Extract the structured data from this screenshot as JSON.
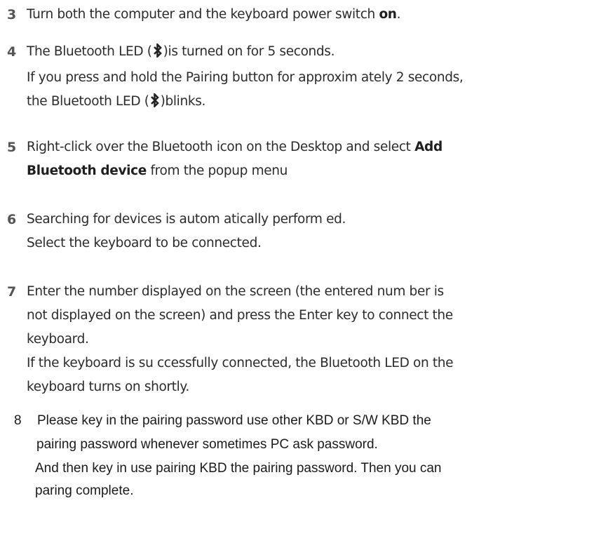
{
  "steps": [
    {
      "number": "3",
      "lines": [
        {
          "pre": "Turn both the computer and the keyboard power switch ",
          "bold": "on",
          "post": "."
        }
      ]
    },
    {
      "number": "4",
      "lines": [
        {
          "pre": "The Bluetooth LED (",
          "icon": "bluetooth-icon",
          "post": ")is turned on for 5 seconds."
        },
        {
          "text": "If you press and hold the Pairing button for approxim ately 2 seconds,"
        },
        {
          "pre": "the Bluetooth LED (",
          "icon": "bluetooth-icon",
          "post": ")blinks."
        }
      ]
    },
    {
      "number": "5",
      "lines": [
        {
          "pre": "Right-click over the Bluetooth icon on the Desktop and select ",
          "bold": "Add"
        },
        {
          "bold": "Bluetooth device",
          "post": " from the popup menu"
        }
      ]
    },
    {
      "number": "6",
      "lines": [
        {
          "text": "Searching for devices is autom atically perform ed."
        },
        {
          "text": "Select the keyboard to be connected."
        }
      ]
    },
    {
      "number": "7",
      "lines": [
        {
          "text": "Enter the number displayed on the screen (the entered num ber is"
        },
        {
          "text": "not displayed on the screen) and press the Enter key to connect the"
        },
        {
          "text": "keyboard."
        },
        {
          "text": "If the keyboard is su ccessfully connected, the Bluetooth LED on the"
        },
        {
          "text": "keyboard turns on shortly."
        }
      ]
    },
    {
      "number": "8",
      "lines": [
        {
          "text": "Please key in the pairing password use other KBD or S/W KBD the"
        },
        {
          "text": "pairing password whenever sometimes PC ask password."
        },
        {
          "text": "And then key in use pairing KBD the pairing password.  Then you can"
        },
        {
          "text": "paring complete."
        }
      ]
    }
  ],
  "colors": {
    "text": "#2b2b2b",
    "number": "#555555",
    "step8_text": "#1a1a1a",
    "background": "#ffffff"
  }
}
